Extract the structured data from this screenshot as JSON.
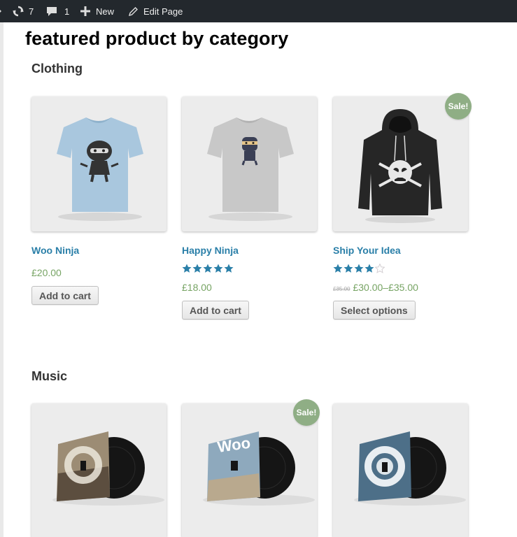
{
  "adminbar": {
    "updates_count": "7",
    "comments_count": "1",
    "new_label": "New",
    "edit_label": "Edit Page"
  },
  "page": {
    "title": "featured product by category"
  },
  "sections": [
    {
      "title": "Clothing",
      "products": [
        {
          "name": "Woo Ninja",
          "price": "£20.00",
          "rating": 0,
          "button": "Add to cart",
          "sale": false,
          "image": "light-blue-ninja-tshirt"
        },
        {
          "name": "Happy Ninja",
          "price": "£18.00",
          "rating": 5,
          "button": "Add to cart",
          "sale": false,
          "image": "grey-ninja-tshirt"
        },
        {
          "name": "Ship Your Idea",
          "old_price": "£35.00",
          "price": "£30.00–£35.00",
          "rating": 4,
          "button": "Select options",
          "sale": true,
          "sale_label": "Sale!",
          "image": "black-skull-hoodie"
        }
      ]
    },
    {
      "title": "Music",
      "products": [
        {
          "sale": false,
          "image": "woothemes-vinyl-album"
        },
        {
          "sale": true,
          "sale_label": "Sale!",
          "image": "woo-vinyl-album"
        },
        {
          "sale": false,
          "image": "woothemes-blue-vinyl-album"
        }
      ]
    }
  ],
  "colors": {
    "adminbar_bg": "#23282d",
    "link": "#2a7fa8",
    "price": "#77a464",
    "sale_badge": "#8fae85",
    "star": "#2a7fa8"
  }
}
